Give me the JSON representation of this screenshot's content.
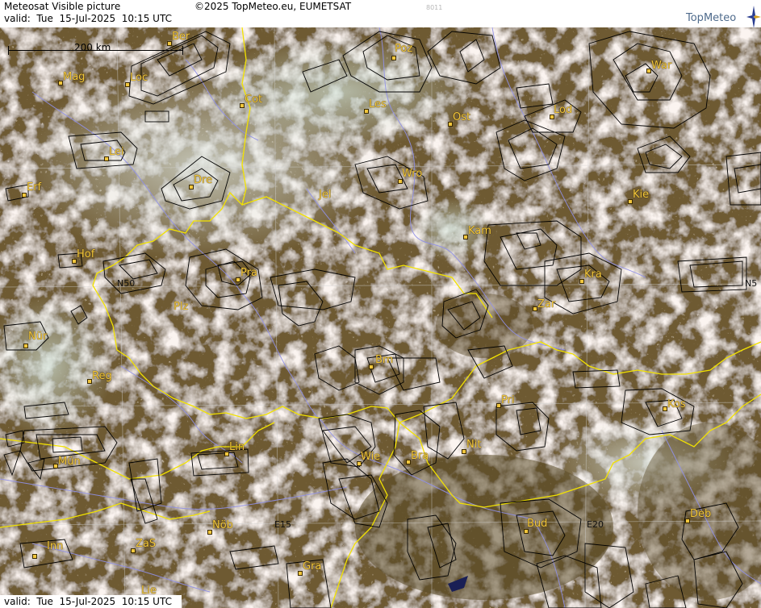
{
  "header": {
    "title": "Meteosat Visible picture",
    "valid": "valid:  Tue  15-Jul-2025  10:15 UTC",
    "copyright": "©2025 TopMeteo.eu, EUMETSAT",
    "frame_id": "8011",
    "logo_text": "TopMeteo"
  },
  "footer": {
    "valid": "valid:  Tue  15-Jul-2025  10:15 UTC"
  },
  "scale": {
    "label": "200 km"
  },
  "grid_labels": [
    {
      "id": "n50-west",
      "text": "N50"
    },
    {
      "id": "n50-east",
      "text": "N5"
    },
    {
      "id": "e15",
      "text": "E15"
    },
    {
      "id": "e20",
      "text": "E20"
    }
  ],
  "cities": [
    {
      "id": "ber",
      "name": "Ber"
    },
    {
      "id": "poz",
      "name": "Poz"
    },
    {
      "id": "war",
      "name": "War"
    },
    {
      "id": "mag",
      "name": "Mag"
    },
    {
      "id": "loc",
      "name": "Loc"
    },
    {
      "id": "cot",
      "name": "Cot"
    },
    {
      "id": "les",
      "name": "Les"
    },
    {
      "id": "ost",
      "name": "Ost"
    },
    {
      "id": "lod",
      "name": "Lod"
    },
    {
      "id": "lei",
      "name": "Lei"
    },
    {
      "id": "dre",
      "name": "Dre"
    },
    {
      "id": "wro",
      "name": "Wro"
    },
    {
      "id": "erf",
      "name": "Erf"
    },
    {
      "id": "jel",
      "name": "Jel"
    },
    {
      "id": "kie",
      "name": "Kie"
    },
    {
      "id": "kam",
      "name": "Kam"
    },
    {
      "id": "hof",
      "name": "Hof"
    },
    {
      "id": "pra",
      "name": "Pra"
    },
    {
      "id": "kra",
      "name": "Kra"
    },
    {
      "id": "plz",
      "name": "Plz"
    },
    {
      "id": "zar",
      "name": "Zar"
    },
    {
      "id": "nur",
      "name": "Nür"
    },
    {
      "id": "brn",
      "name": "Brn"
    },
    {
      "id": "reg",
      "name": "Reg"
    },
    {
      "id": "pri",
      "name": "Pri"
    },
    {
      "id": "kos",
      "name": "Kos"
    },
    {
      "id": "lin",
      "name": "Lin"
    },
    {
      "id": "nit",
      "name": "Nit"
    },
    {
      "id": "mun",
      "name": "Mün"
    },
    {
      "id": "wie",
      "name": "Wie"
    },
    {
      "id": "bra",
      "name": "Bra"
    },
    {
      "id": "nob",
      "name": "Nöb"
    },
    {
      "id": "bud",
      "name": "Bud"
    },
    {
      "id": "deb",
      "name": "Deb"
    },
    {
      "id": "inn",
      "name": "Inn"
    },
    {
      "id": "zas",
      "name": "ZaS"
    },
    {
      "id": "gra",
      "name": "Gra"
    },
    {
      "id": "lie",
      "name": "Lie"
    }
  ],
  "colors": {
    "terrain": "#6e5a32",
    "cloud": "#f0e8e0",
    "border": "#f2e200",
    "river": "#9090e8",
    "airspace": "#000000",
    "city_label": "#f2c73d",
    "logo_text": "#4f6b8c"
  }
}
